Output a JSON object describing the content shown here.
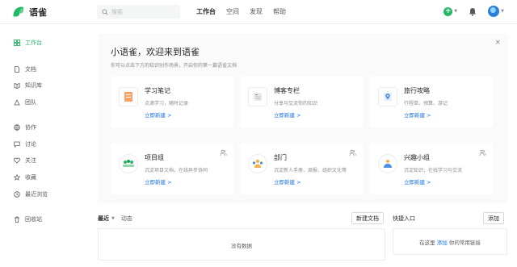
{
  "header": {
    "brand": "语雀",
    "search_placeholder": "搜索",
    "nav": [
      {
        "label": "工作台",
        "active": true
      },
      {
        "label": "空间",
        "active": false
      },
      {
        "label": "发现",
        "active": false
      },
      {
        "label": "帮助",
        "active": false
      }
    ],
    "plus_icon": "plus-circle-icon",
    "bell_icon": "bell-icon",
    "accent_color": "#25b864"
  },
  "sidebar": {
    "items": [
      {
        "label": "工作台",
        "icon": "grid-icon",
        "active": true
      },
      {
        "label": "文档",
        "icon": "doc-icon"
      },
      {
        "label": "知识库",
        "icon": "book-icon"
      },
      {
        "label": "团队",
        "icon": "team-icon"
      },
      {
        "label": "协作",
        "icon": "globe-icon"
      },
      {
        "label": "讨论",
        "icon": "chat-icon"
      },
      {
        "label": "关注",
        "icon": "heart-icon"
      },
      {
        "label": "收藏",
        "icon": "star-icon"
      },
      {
        "label": "最近浏览",
        "icon": "clock-icon"
      },
      {
        "label": "回收站",
        "icon": "trash-icon"
      }
    ]
  },
  "welcome": {
    "title": "小语雀，欢迎来到语雀",
    "subtitle": "你可以点击下方的知识创作场景，开启你的第一篇语雀文档",
    "close": "×",
    "cards": [
      {
        "title": "学习笔记",
        "desc": "点滴学习，随时记录",
        "link": "立即新建 >",
        "icon": "notebook-icon"
      },
      {
        "title": "博客专栏",
        "desc": "分享与交流你的知识",
        "link": "立即新建 >",
        "icon": "blog-icon"
      },
      {
        "title": "旅行攻略",
        "desc": "行程单、预算、游记",
        "link": "立即新建 >",
        "icon": "map-pin-icon"
      },
      {
        "title": "项目组",
        "desc": "沉淀项目文档，在线异步协同",
        "link": "立即新建 >",
        "icon": "project-icon"
      },
      {
        "title": "部门",
        "desc": "沉淀新人手册、周报、组织文化等",
        "link": "立即新建 >",
        "icon": "department-icon"
      },
      {
        "title": "兴趣小组",
        "desc": "沉淀知识，在线学习与交流",
        "link": "立即新建 >",
        "icon": "interest-group-icon"
      }
    ]
  },
  "recent": {
    "tab_active": "最近",
    "tab_other": "动态",
    "new_doc_button": "新建文档",
    "empty_text": "没有数据"
  },
  "quick": {
    "title": "快捷入口",
    "add_button": "添加",
    "text_before": "在这里",
    "text_link": "添加",
    "text_after": "你的常用链接"
  }
}
